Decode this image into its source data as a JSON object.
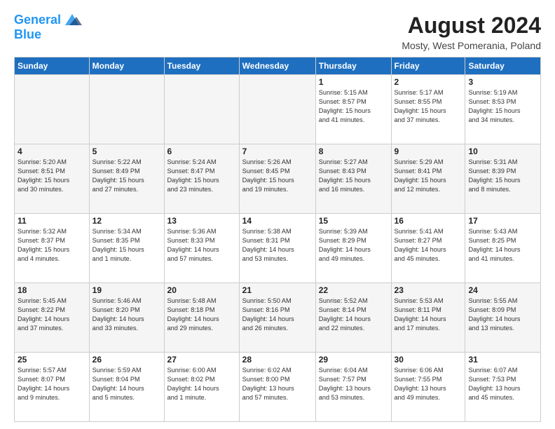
{
  "header": {
    "logo_line1": "General",
    "logo_line2": "Blue",
    "month_year": "August 2024",
    "location": "Mosty, West Pomerania, Poland"
  },
  "weekdays": [
    "Sunday",
    "Monday",
    "Tuesday",
    "Wednesday",
    "Thursday",
    "Friday",
    "Saturday"
  ],
  "weeks": [
    [
      {
        "day": "",
        "info": ""
      },
      {
        "day": "",
        "info": ""
      },
      {
        "day": "",
        "info": ""
      },
      {
        "day": "",
        "info": ""
      },
      {
        "day": "1",
        "info": "Sunrise: 5:15 AM\nSunset: 8:57 PM\nDaylight: 15 hours\nand 41 minutes."
      },
      {
        "day": "2",
        "info": "Sunrise: 5:17 AM\nSunset: 8:55 PM\nDaylight: 15 hours\nand 37 minutes."
      },
      {
        "day": "3",
        "info": "Sunrise: 5:19 AM\nSunset: 8:53 PM\nDaylight: 15 hours\nand 34 minutes."
      }
    ],
    [
      {
        "day": "4",
        "info": "Sunrise: 5:20 AM\nSunset: 8:51 PM\nDaylight: 15 hours\nand 30 minutes."
      },
      {
        "day": "5",
        "info": "Sunrise: 5:22 AM\nSunset: 8:49 PM\nDaylight: 15 hours\nand 27 minutes."
      },
      {
        "day": "6",
        "info": "Sunrise: 5:24 AM\nSunset: 8:47 PM\nDaylight: 15 hours\nand 23 minutes."
      },
      {
        "day": "7",
        "info": "Sunrise: 5:26 AM\nSunset: 8:45 PM\nDaylight: 15 hours\nand 19 minutes."
      },
      {
        "day": "8",
        "info": "Sunrise: 5:27 AM\nSunset: 8:43 PM\nDaylight: 15 hours\nand 16 minutes."
      },
      {
        "day": "9",
        "info": "Sunrise: 5:29 AM\nSunset: 8:41 PM\nDaylight: 15 hours\nand 12 minutes."
      },
      {
        "day": "10",
        "info": "Sunrise: 5:31 AM\nSunset: 8:39 PM\nDaylight: 15 hours\nand 8 minutes."
      }
    ],
    [
      {
        "day": "11",
        "info": "Sunrise: 5:32 AM\nSunset: 8:37 PM\nDaylight: 15 hours\nand 4 minutes."
      },
      {
        "day": "12",
        "info": "Sunrise: 5:34 AM\nSunset: 8:35 PM\nDaylight: 15 hours\nand 1 minute."
      },
      {
        "day": "13",
        "info": "Sunrise: 5:36 AM\nSunset: 8:33 PM\nDaylight: 14 hours\nand 57 minutes."
      },
      {
        "day": "14",
        "info": "Sunrise: 5:38 AM\nSunset: 8:31 PM\nDaylight: 14 hours\nand 53 minutes."
      },
      {
        "day": "15",
        "info": "Sunrise: 5:39 AM\nSunset: 8:29 PM\nDaylight: 14 hours\nand 49 minutes."
      },
      {
        "day": "16",
        "info": "Sunrise: 5:41 AM\nSunset: 8:27 PM\nDaylight: 14 hours\nand 45 minutes."
      },
      {
        "day": "17",
        "info": "Sunrise: 5:43 AM\nSunset: 8:25 PM\nDaylight: 14 hours\nand 41 minutes."
      }
    ],
    [
      {
        "day": "18",
        "info": "Sunrise: 5:45 AM\nSunset: 8:22 PM\nDaylight: 14 hours\nand 37 minutes."
      },
      {
        "day": "19",
        "info": "Sunrise: 5:46 AM\nSunset: 8:20 PM\nDaylight: 14 hours\nand 33 minutes."
      },
      {
        "day": "20",
        "info": "Sunrise: 5:48 AM\nSunset: 8:18 PM\nDaylight: 14 hours\nand 29 minutes."
      },
      {
        "day": "21",
        "info": "Sunrise: 5:50 AM\nSunset: 8:16 PM\nDaylight: 14 hours\nand 26 minutes."
      },
      {
        "day": "22",
        "info": "Sunrise: 5:52 AM\nSunset: 8:14 PM\nDaylight: 14 hours\nand 22 minutes."
      },
      {
        "day": "23",
        "info": "Sunrise: 5:53 AM\nSunset: 8:11 PM\nDaylight: 14 hours\nand 17 minutes."
      },
      {
        "day": "24",
        "info": "Sunrise: 5:55 AM\nSunset: 8:09 PM\nDaylight: 14 hours\nand 13 minutes."
      }
    ],
    [
      {
        "day": "25",
        "info": "Sunrise: 5:57 AM\nSunset: 8:07 PM\nDaylight: 14 hours\nand 9 minutes."
      },
      {
        "day": "26",
        "info": "Sunrise: 5:59 AM\nSunset: 8:04 PM\nDaylight: 14 hours\nand 5 minutes."
      },
      {
        "day": "27",
        "info": "Sunrise: 6:00 AM\nSunset: 8:02 PM\nDaylight: 14 hours\nand 1 minute."
      },
      {
        "day": "28",
        "info": "Sunrise: 6:02 AM\nSunset: 8:00 PM\nDaylight: 13 hours\nand 57 minutes."
      },
      {
        "day": "29",
        "info": "Sunrise: 6:04 AM\nSunset: 7:57 PM\nDaylight: 13 hours\nand 53 minutes."
      },
      {
        "day": "30",
        "info": "Sunrise: 6:06 AM\nSunset: 7:55 PM\nDaylight: 13 hours\nand 49 minutes."
      },
      {
        "day": "31",
        "info": "Sunrise: 6:07 AM\nSunset: 7:53 PM\nDaylight: 13 hours\nand 45 minutes."
      }
    ]
  ]
}
